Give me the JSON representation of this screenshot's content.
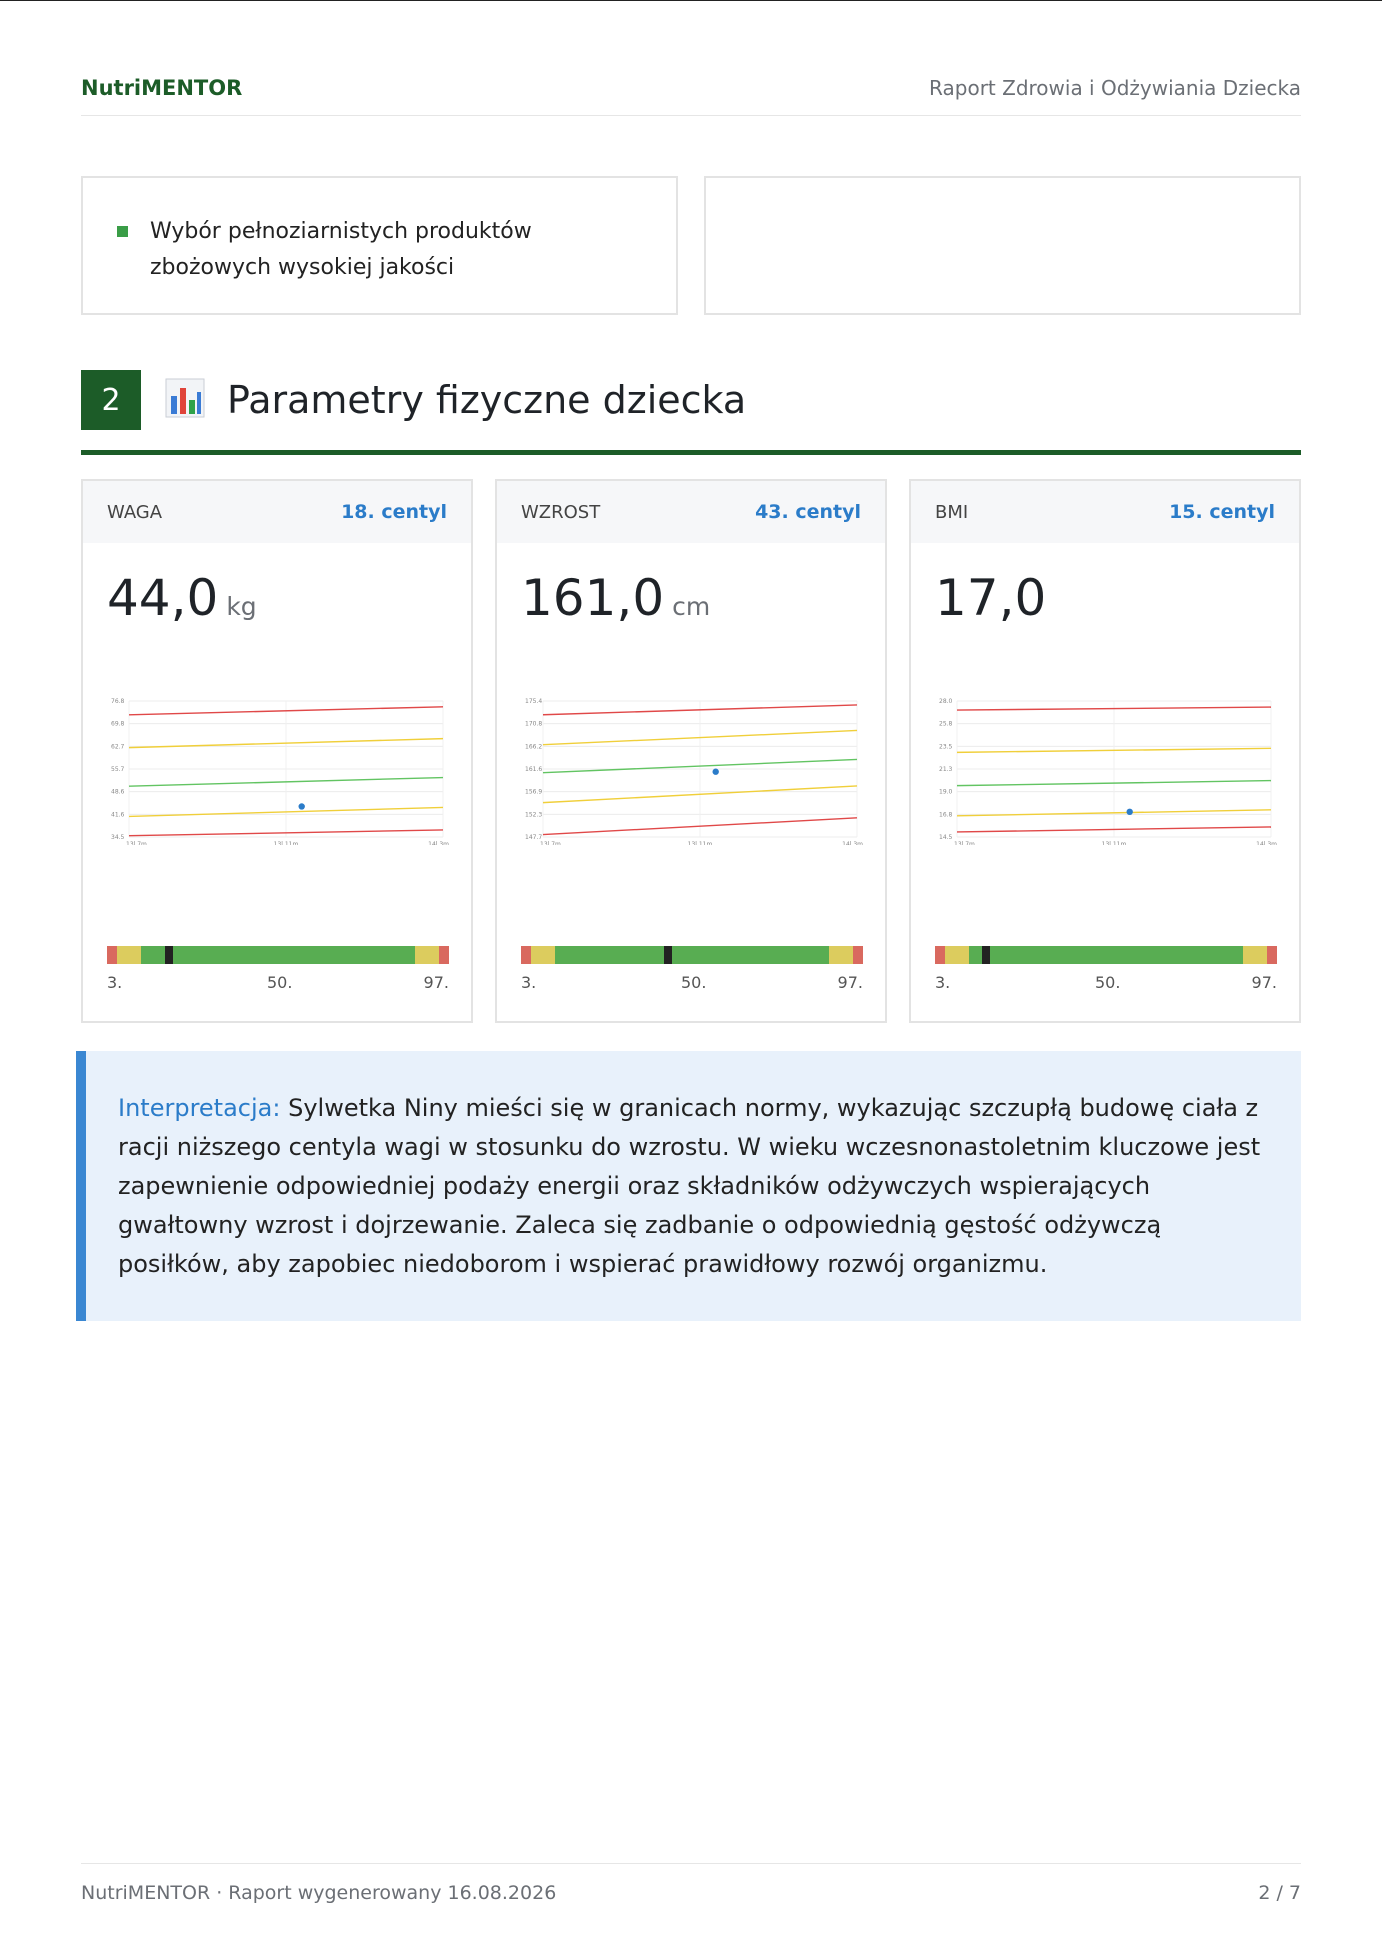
{
  "header": {
    "brand": "NutriMENTOR",
    "title": "Raport Zdrowia i Odżywiania Dziecka"
  },
  "recommendation": {
    "text": "Wybór pełnoziarnistych produktów zbożowych wysokiej jakości"
  },
  "section": {
    "number": "2",
    "icon": "bar-chart-icon",
    "title": "Parametry fizyczne dziecka"
  },
  "metrics": [
    {
      "label": "WAGA",
      "centyl": "18. centyl",
      "value": "44,0",
      "unit": "kg",
      "percentile": 18
    },
    {
      "label": "WZROST",
      "centyl": "43. centyl",
      "value": "161,0",
      "unit": "cm",
      "percentile": 43
    },
    {
      "label": "BMI",
      "centyl": "15. centyl",
      "value": "17,0",
      "unit": "",
      "percentile": 15
    }
  ],
  "percentile_scale": {
    "p3": "3.",
    "p50": "50.",
    "p97": "97."
  },
  "chart_data": [
    {
      "type": "line",
      "yticks": [
        "76.8",
        "69.8",
        "62.7",
        "55.7",
        "48.6",
        "41.6",
        "34.5"
      ],
      "xticks": [
        "13l 7m",
        "13l 11m",
        "14l 3m"
      ],
      "ylim": [
        34.5,
        76.8
      ],
      "series": [
        {
          "values": [
            34.9,
            36.7
          ],
          "color": "#e04848"
        },
        {
          "values": [
            40.9,
            43.7
          ],
          "color": "#f0cf3a"
        },
        {
          "values": [
            50.3,
            53.0
          ],
          "color": "#62c462"
        },
        {
          "values": [
            62.3,
            65.1
          ],
          "color": "#f0cf3a"
        },
        {
          "values": [
            72.5,
            75.0
          ],
          "color": "#e04848"
        }
      ],
      "point": {
        "x": 0.55,
        "y": 44.0,
        "color": "#2b7cc9"
      }
    },
    {
      "type": "line",
      "yticks": [
        "175.4",
        "170.8",
        "166.2",
        "161.6",
        "156.9",
        "152.3",
        "147.7"
      ],
      "xticks": [
        "13l 7m",
        "13l 11m",
        "14l 3m"
      ],
      "ylim": [
        147.7,
        175.4
      ],
      "series": [
        {
          "values": [
            148.2,
            151.6
          ],
          "color": "#e04848"
        },
        {
          "values": [
            154.7,
            158.1
          ],
          "color": "#f0cf3a"
        },
        {
          "values": [
            160.8,
            163.5
          ],
          "color": "#62c462"
        },
        {
          "values": [
            166.5,
            169.4
          ],
          "color": "#f0cf3a"
        },
        {
          "values": [
            172.6,
            174.6
          ],
          "color": "#e04848"
        }
      ],
      "point": {
        "x": 0.55,
        "y": 161.0,
        "color": "#2b7cc9"
      }
    },
    {
      "type": "line",
      "yticks": [
        "28.0",
        "25.8",
        "23.5",
        "21.3",
        "19.0",
        "16.8",
        "14.5"
      ],
      "xticks": [
        "13l 7m",
        "13l 11m",
        "14l 3m"
      ],
      "ylim": [
        14.5,
        28.0
      ],
      "series": [
        {
          "values": [
            15.0,
            15.5
          ],
          "color": "#e04848"
        },
        {
          "values": [
            16.6,
            17.2
          ],
          "color": "#f0cf3a"
        },
        {
          "values": [
            19.6,
            20.1
          ],
          "color": "#62c462"
        },
        {
          "values": [
            22.9,
            23.3
          ],
          "color": "#f0cf3a"
        },
        {
          "values": [
            27.1,
            27.4
          ],
          "color": "#e04848"
        }
      ],
      "point": {
        "x": 0.55,
        "y": 17.0,
        "color": "#2b7cc9"
      }
    }
  ],
  "interpretation": {
    "label": "Interpretacja:",
    "text": "Sylwetka Niny mieści się w granicach normy, wykazując szczupłą budowę ciała z racji niższego centyla wagi w stosunku do wzrostu. W wieku wczesnonastoletnim kluczowe jest zapewnienie odpowiedniej podaży energii oraz składników odżywczych wspierających gwałtowny wzrost i dojrzewanie. Zaleca się zadbanie o odpowiednią gęstość odżywczą posiłków, aby zapobiec niedoborom i wspierać prawidłowy rozwój organizmu."
  },
  "footer": {
    "left": "NutriMENTOR · Raport wygenerowany 16.08.2026",
    "page": "2 / 7"
  }
}
